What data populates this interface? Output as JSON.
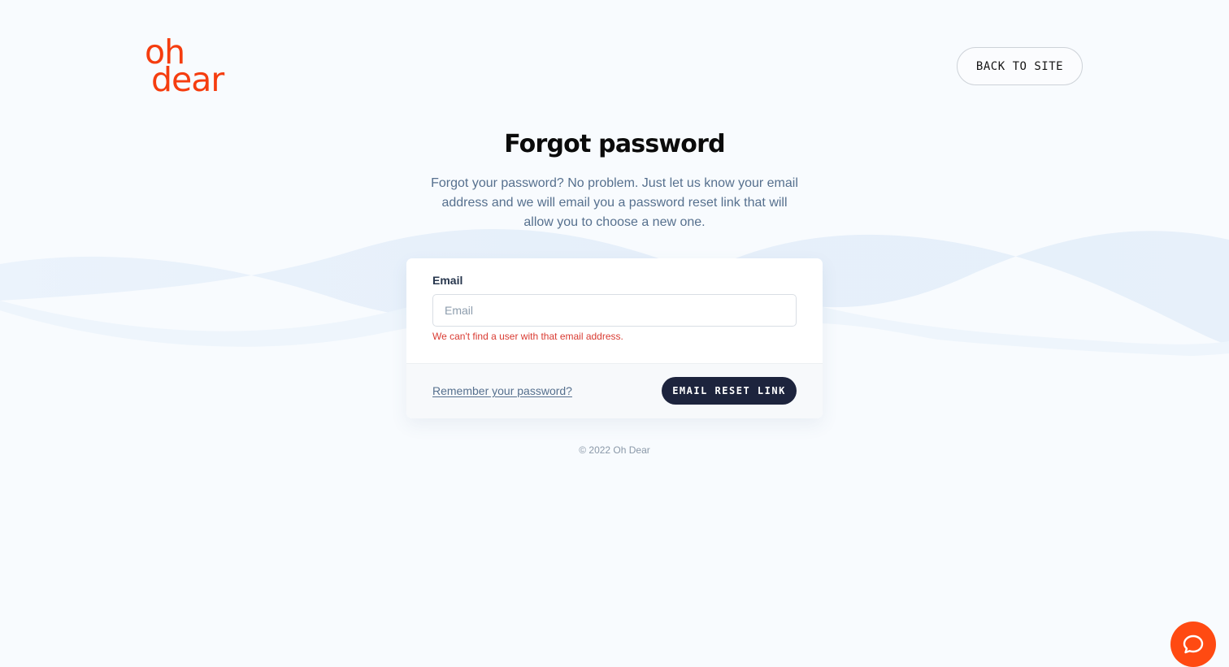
{
  "brand": {
    "logo_line_1": "oh",
    "logo_line_2": "dear",
    "accent_color": "#f53d0f"
  },
  "header": {
    "back_label": "BACK TO SITE"
  },
  "main": {
    "title": "Forgot password",
    "description": "Forgot your password? No problem. Just let us know your email address and we will email you a password reset link that will allow you to choose a new one."
  },
  "form": {
    "email_label": "Email",
    "email_placeholder": "Email",
    "email_value": "",
    "error_message": "We can't find a user with that email address.",
    "remember_link": "Remember your password?",
    "submit_label": "EMAIL RESET LINK"
  },
  "footer": {
    "copyright": "© 2022 Oh Dear"
  },
  "chat": {
    "icon": "chat-bubble-icon",
    "color": "#ff4a12"
  }
}
